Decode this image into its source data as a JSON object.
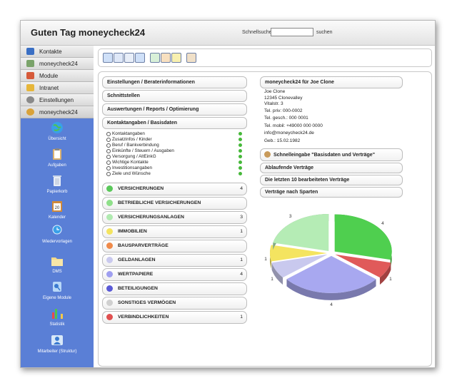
{
  "header": {
    "greeting": "Guten Tag moneycheck24",
    "search_label": "Schnellsuche:",
    "search_value": "",
    "search_button": "suchen"
  },
  "sidebar": {
    "nav": [
      {
        "label": "Kontakte",
        "icon": "contacts-icon",
        "color": "#3a6fc4"
      },
      {
        "label": "moneycheck24",
        "icon": "calculator-icon",
        "color": "#7aa36a"
      },
      {
        "label": "Module",
        "icon": "module-icon",
        "color": "#d65a3a"
      },
      {
        "label": "Intranet",
        "icon": "intranet-icon",
        "color": "#e6b63a"
      },
      {
        "label": "Einstellungen",
        "icon": "info-icon",
        "color": "#8a8a8a"
      },
      {
        "label": "moneycheck24",
        "icon": "user-icon",
        "color": "#d9a23a"
      }
    ],
    "tiles": [
      {
        "label": "Übersicht",
        "icon": "globe-icon"
      },
      {
        "label": "Aufgaben",
        "icon": "clipboard-icon"
      },
      {
        "label": "Papierkorb",
        "icon": "trash-icon"
      },
      {
        "label": "Kalender",
        "icon": "calendar-icon",
        "day": "20"
      },
      {
        "label": "Wiedervorlagen",
        "icon": "clock-icon"
      },
      {
        "label": "DMS",
        "icon": "folder-icon"
      },
      {
        "label": "Eigene Module",
        "icon": "modules-icon"
      },
      {
        "label": "Statistik",
        "icon": "bar-chart-icon"
      },
      {
        "label": "Mitarbeiter (Struktur)",
        "icon": "team-icon"
      }
    ]
  },
  "toolbar": {
    "icons": [
      "list-view-icon",
      "window-icon",
      "magnifier-icon",
      "document-icon",
      "table-icon",
      "chart-icon",
      "lightbulb-icon",
      "person-icon"
    ]
  },
  "left_sections": {
    "settings": "Einstellungen / Beraterinformationen",
    "interfaces": "Schnittstellen",
    "reports": "Auswertungen / Reports / Optimierung",
    "contact_data": "Kontaktangaben / Basisdaten"
  },
  "contact_items": [
    "Kontaktangaben",
    "Zusatzinfos / Kinder",
    "Beruf / Bankverbindung",
    "Einkünfte / Steuern / Ausgaben",
    "Versorgung / AltEinkG",
    "Wichtige Kontakte",
    "Investitionsangaben",
    "Ziele und Wünsche"
  ],
  "categories": [
    {
      "label": "VERSICHERUNGEN",
      "count": "4",
      "color": "#5ac85a"
    },
    {
      "label": "BETRIEBLICHE VERSICHERUNGEN",
      "count": "",
      "color": "#8fe08a"
    },
    {
      "label": "VERSICHERUNGSANLAGEN",
      "count": "3",
      "color": "#b0eab0"
    },
    {
      "label": "IMMOBILIEN",
      "count": "1",
      "color": "#f4e460"
    },
    {
      "label": "BAUSPARVERTRÄGE",
      "count": "",
      "color": "#ef8a4a"
    },
    {
      "label": "GELDANLAGEN",
      "count": "1",
      "color": "#c9c9ee"
    },
    {
      "label": "WERTPAPIERE",
      "count": "4",
      "color": "#9f9ff0"
    },
    {
      "label": "BETEILIGUNGEN",
      "count": "",
      "color": "#5a5ad6"
    },
    {
      "label": "SONSTIGES VERMÖGEN",
      "count": "",
      "color": "#d0d0d0"
    },
    {
      "label": "VERBINDLICHKEITEN",
      "count": "1",
      "color": "#e05050"
    }
  ],
  "right": {
    "title": "moneycheck24 für Joe Clone",
    "contact": {
      "name": "Joe Clone",
      "city": "12345 Clonevalley",
      "street": "Vitalstr. 3",
      "tel_priv": "Tel. priv: 000-0002",
      "tel_gesch": "Tel. gesch.: 000 0001",
      "tel_mobil": "Tel. mobil: +49000 000 0000",
      "email": "info@moneycheck24.de",
      "birth": "Geb.: 15.02.1982"
    },
    "quick_entry": "Schnelleingabe \"Basisdaten und Verträge\"",
    "expiring": "Ablaufende Verträge",
    "last_edited": "Die letzten 10 bearbeiteten Verträge",
    "by_category": "Verträge nach Sparten"
  },
  "chart_data": {
    "type": "pie",
    "values": [
      4,
      1,
      4,
      1,
      1,
      3
    ],
    "colors": [
      "#4fcf4f",
      "#e05a5a",
      "#a8a8f0",
      "#c9c9ee",
      "#f4e460",
      "#b5ecb5"
    ],
    "labels": [
      "4",
      "1",
      "4",
      "1",
      "1",
      "3"
    ]
  }
}
